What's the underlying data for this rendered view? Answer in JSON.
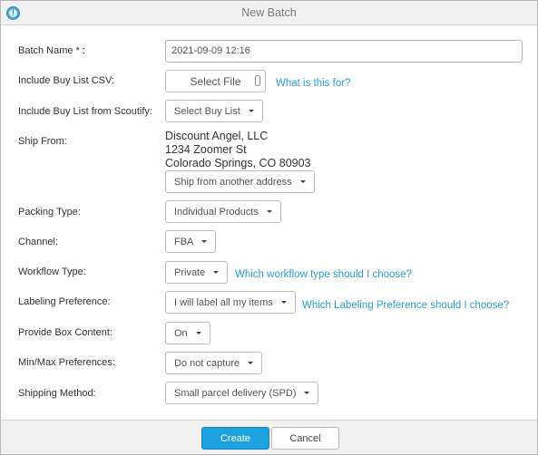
{
  "dialog": {
    "title": "New Batch"
  },
  "form": {
    "batch_name": {
      "label": "Batch Name * :",
      "value": "2021-09-09 12:16"
    },
    "buy_list_csv": {
      "label": "Include Buy List CSV:",
      "button": "Select File",
      "help_link": "What is this for?"
    },
    "buy_list_scoutify": {
      "label": "Include Buy List from Scoutify:",
      "button": "Select Buy List"
    },
    "ship_from": {
      "label": "Ship From:",
      "address_line1": "Discount Angel, LLC",
      "address_line2": "1234 Zoomer St",
      "address_line3": "Colorado Springs, CO 80903",
      "button": "Ship from another address"
    },
    "packing_type": {
      "label": "Packing Type:",
      "selected": "Individual Products"
    },
    "channel": {
      "label": "Channel:",
      "selected": "FBA"
    },
    "workflow_type": {
      "label": "Workflow Type:",
      "selected": "Private",
      "help_link": "Which workflow type should I choose?"
    },
    "labeling_preference": {
      "label": "Labeling Preference:",
      "selected": "I will label all my items",
      "help_link": "Which Labeling Preference should I choose?"
    },
    "box_content": {
      "label": "Provide Box Content:",
      "selected": "On"
    },
    "minmax": {
      "label": "Min/Max Preferences:",
      "selected": "Do not capture"
    },
    "shipping_method": {
      "label": "Shipping Method:",
      "selected": "Small parcel delivery (SPD)"
    }
  },
  "footer": {
    "create": "Create",
    "cancel": "Cancel"
  },
  "colors": {
    "accent": "#1da1e1",
    "link": "#2a9fd8"
  }
}
